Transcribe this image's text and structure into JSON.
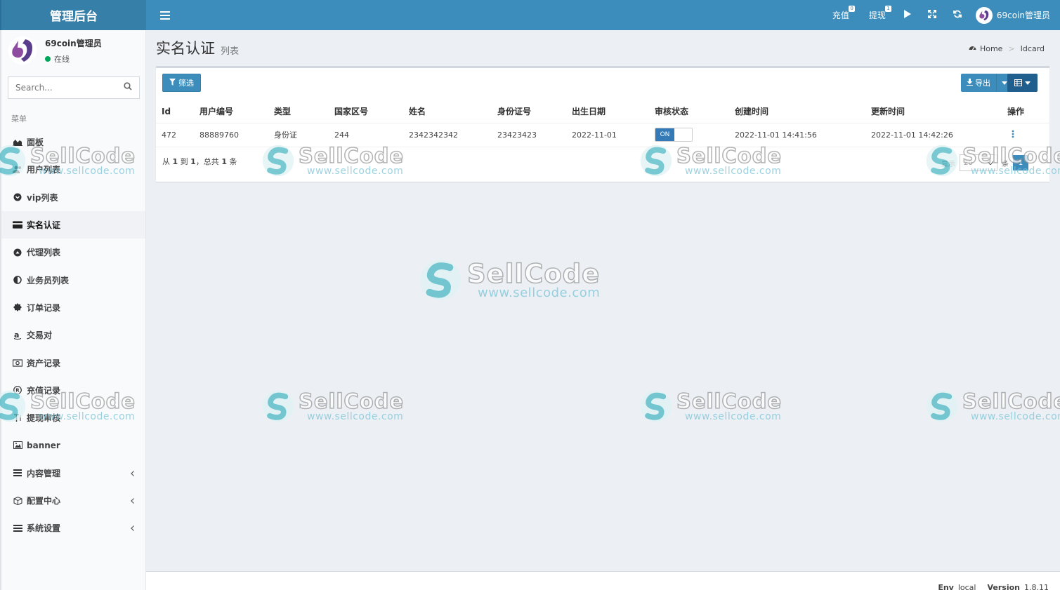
{
  "header": {
    "logo": "管理后台",
    "recharge": {
      "label": "充值",
      "count": "0"
    },
    "withdraw": {
      "label": "提现",
      "count": "1"
    },
    "user": "69coin管理员"
  },
  "sidebar": {
    "user_name": "69coin管理员",
    "user_status": "在线",
    "search_placeholder": "Search...",
    "menu_header": "菜单",
    "items": [
      {
        "label": "面板",
        "icon": "area-chart-icon"
      },
      {
        "label": "用户列表",
        "icon": "users-icon"
      },
      {
        "label": "vip列表",
        "icon": "chevron-circle-down-icon"
      },
      {
        "label": "实名认证",
        "icon": "credit-card-icon",
        "active": true
      },
      {
        "label": "代理列表",
        "icon": "eject-circle-icon"
      },
      {
        "label": "业务员列表",
        "icon": "adjust-icon"
      },
      {
        "label": "订单记录",
        "icon": "certificate-icon"
      },
      {
        "label": "交易对",
        "icon": "amazon-icon"
      },
      {
        "label": "资产记录",
        "icon": "money-icon"
      },
      {
        "label": "充值记录",
        "icon": "registered-icon"
      },
      {
        "label": "提现审核",
        "icon": "text-height-icon"
      },
      {
        "label": "banner",
        "icon": "image-icon"
      },
      {
        "label": "内容管理",
        "icon": "bars-icon",
        "submenu": true
      },
      {
        "label": "配置中心",
        "icon": "cube-icon",
        "submenu": true
      },
      {
        "label": "系统设置",
        "icon": "cogs-icon",
        "submenu": true
      }
    ]
  },
  "page": {
    "title": "实名认证",
    "subtitle": "列表",
    "breadcrumb_home": "Home",
    "breadcrumb_current": "Idcard"
  },
  "toolbar": {
    "filter_label": "筛选",
    "export_label": "导出"
  },
  "table": {
    "columns": [
      "Id",
      "用户编号",
      "类型",
      "国家区号",
      "姓名",
      "身份证号",
      "出生日期",
      "审核状态",
      "创建时间",
      "更新时间",
      "操作"
    ],
    "rows": [
      {
        "id": "472",
        "user_no": "88889760",
        "type": "身份证",
        "country_code": "244",
        "name": "2342342342",
        "id_number": "23423423",
        "birth": "2022-11-01",
        "status": "ON",
        "created": "2022-11-01 14:41:56",
        "updated": "2022-11-01 14:42:26"
      }
    ]
  },
  "pagination": {
    "prefix": "从",
    "from": "1",
    "to_word": "到",
    "to": "1",
    "total_word": "，总共",
    "total": "1",
    "suffix": "条",
    "show_label": "显示",
    "page_size": "20",
    "per_label": "条",
    "current_page": "1"
  },
  "footer": {
    "env_label": "Env",
    "env_value": "local",
    "version_label": "Version",
    "version_value": "1.8.11"
  },
  "watermark": {
    "text": "SellCode",
    "url": "www.sellcode.com"
  },
  "colors": {
    "primary": "#3c8dbc",
    "header_dark": "#367fa9",
    "success": "#00a65a"
  }
}
